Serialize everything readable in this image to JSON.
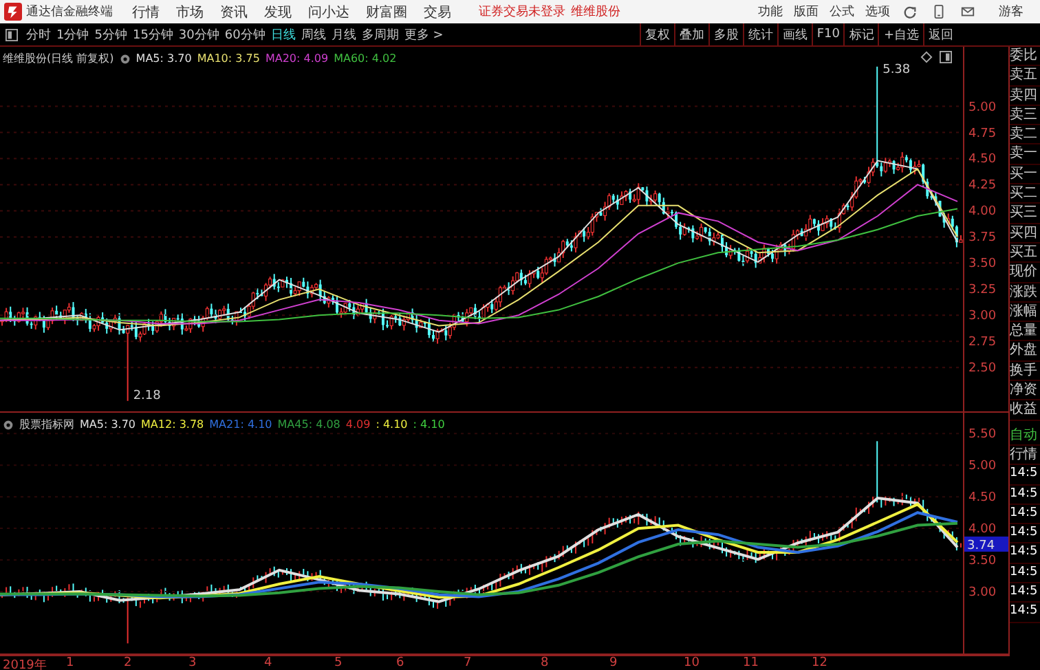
{
  "menubar": {
    "app_title": "通达信金融终端",
    "menus": [
      "行情",
      "市场",
      "资讯",
      "发现",
      "问小达",
      "财富圈",
      "交易"
    ],
    "notice": "证券交易未登录",
    "stock_name": "维维股份",
    "actions": [
      "功能",
      "版面",
      "公式",
      "选项"
    ],
    "user": "游客"
  },
  "toolbar": {
    "periods": [
      {
        "label": "分时",
        "selected": false
      },
      {
        "label": "1分钟",
        "selected": false
      },
      {
        "label": "5分钟",
        "selected": false
      },
      {
        "label": "15分钟",
        "selected": false
      },
      {
        "label": "30分钟",
        "selected": false
      },
      {
        "label": "60分钟",
        "selected": false
      },
      {
        "label": "日线",
        "selected": true
      },
      {
        "label": "周线",
        "selected": false
      },
      {
        "label": "月线",
        "selected": false
      },
      {
        "label": "多周期",
        "selected": false
      },
      {
        "label": "更多 >",
        "selected": false
      }
    ],
    "buttons": [
      "复权",
      "叠加",
      "多股",
      "统计",
      "画线",
      "F10",
      "标记",
      "+自选",
      "返回"
    ]
  },
  "main_chart": {
    "title": "维维股份(日线 前复权)",
    "readings": [
      ": 3.70",
      ": 3.75",
      ": 4.09",
      ": 4.02"
    ],
    "high_label": "5.38",
    "low_label": "2.18",
    "chart_data": {
      "type": "line",
      "grid": true,
      "ylim": [
        2.08,
        5.57
      ],
      "yticks": [
        {
          "value": 5.0,
          "label": "5.00"
        },
        {
          "value": 4.75,
          "label": "4.75"
        },
        {
          "value": 4.5,
          "label": "4.50"
        },
        {
          "value": 4.25,
          "label": "4.25"
        },
        {
          "value": 4.0,
          "label": "4.00"
        },
        {
          "value": 3.75,
          "label": "3.75"
        },
        {
          "value": 3.5,
          "label": "3.50"
        },
        {
          "value": 3.25,
          "label": "3.25"
        },
        {
          "value": 3.0,
          "label": "3.00"
        },
        {
          "value": 2.75,
          "label": "2.75"
        },
        {
          "value": 2.5,
          "label": "2.50"
        }
      ],
      "series": [
        {
          "name": "MA5",
          "color": "#e0e0e0",
          "values": [
            2.95,
            2.97,
            3.0,
            2.86,
            2.91,
            2.96,
            3.03,
            3.34,
            3.19,
            3.02,
            2.96,
            2.84,
            3.04,
            3.33,
            3.56,
            3.98,
            4.22,
            3.87,
            3.69,
            3.51,
            3.77,
            3.94,
            4.48,
            4.4,
            3.7
          ]
        },
        {
          "name": "MA10",
          "color": "#e8e070",
          "values": [
            2.95,
            2.96,
            2.98,
            2.93,
            2.9,
            2.93,
            2.98,
            3.15,
            3.25,
            3.1,
            3.0,
            2.9,
            2.93,
            3.15,
            3.42,
            3.7,
            4.05,
            4.05,
            3.8,
            3.6,
            3.62,
            3.85,
            4.15,
            4.4,
            3.75
          ]
        },
        {
          "name": "MA20",
          "color": "#d040d0",
          "values": [
            2.95,
            2.95,
            2.96,
            2.95,
            2.92,
            2.92,
            2.95,
            3.05,
            3.15,
            3.12,
            3.05,
            2.95,
            2.92,
            3.0,
            3.2,
            3.45,
            3.78,
            3.98,
            3.9,
            3.7,
            3.62,
            3.72,
            3.95,
            4.25,
            4.09
          ]
        },
        {
          "name": "MA60",
          "color": "#40c040",
          "values": [
            2.97,
            2.97,
            2.96,
            2.95,
            2.95,
            2.94,
            2.94,
            2.96,
            3.0,
            3.02,
            3.02,
            3.0,
            2.97,
            2.98,
            3.05,
            3.18,
            3.35,
            3.5,
            3.6,
            3.63,
            3.66,
            3.72,
            3.82,
            3.95,
            4.02
          ]
        }
      ]
    }
  },
  "indicator_chart": {
    "title": "股票指标网",
    "readings": [
      ": 3.70",
      ": 3.78",
      ": 4.10",
      ": 4.08"
    ],
    "extra_values": [
      {
        "text": "4.09",
        "color": "#e03030"
      },
      {
        "text": ": 4.10",
        "color": "#f0f040"
      },
      {
        "text": ": 4.10",
        "color": "#40d040"
      }
    ],
    "current_price": "3.74",
    "chart_data": {
      "type": "line",
      "grid": true,
      "ylim": [
        2.02,
        5.83
      ],
      "yticks": [
        {
          "value": 5.5,
          "label": "5.50"
        },
        {
          "value": 5.0,
          "label": "5.00"
        },
        {
          "value": 4.5,
          "label": "4.50"
        },
        {
          "value": 4.0,
          "label": "4.00"
        },
        {
          "value": 3.5,
          "label": "3.50"
        },
        {
          "value": 3.0,
          "label": "3.00"
        }
      ],
      "series": [
        {
          "name": "MA5",
          "color": "#e0e0e0",
          "values": [
            2.95,
            2.97,
            3.0,
            2.86,
            2.91,
            2.96,
            3.03,
            3.34,
            3.19,
            3.02,
            2.96,
            2.84,
            3.04,
            3.33,
            3.56,
            3.98,
            4.22,
            3.87,
            3.69,
            3.51,
            3.77,
            3.94,
            4.48,
            4.4,
            3.7
          ]
        },
        {
          "name": "MA12",
          "color": "#f0f040",
          "values": [
            2.95,
            2.96,
            2.98,
            2.94,
            2.9,
            2.93,
            2.97,
            3.12,
            3.24,
            3.12,
            3.01,
            2.91,
            2.93,
            3.12,
            3.38,
            3.66,
            4.0,
            4.05,
            3.82,
            3.62,
            3.62,
            3.82,
            4.1,
            4.38,
            3.78
          ]
        },
        {
          "name": "MA21",
          "color": "#3070e0",
          "values": [
            2.95,
            2.95,
            2.96,
            2.95,
            2.92,
            2.92,
            2.95,
            3.05,
            3.15,
            3.12,
            3.05,
            2.95,
            2.92,
            3.0,
            3.2,
            3.45,
            3.78,
            3.98,
            3.9,
            3.7,
            3.62,
            3.72,
            3.95,
            4.25,
            4.1
          ]
        },
        {
          "name": "MA45",
          "color": "#30a040",
          "values": [
            2.96,
            2.96,
            2.96,
            2.95,
            2.94,
            2.93,
            2.94,
            2.98,
            3.05,
            3.08,
            3.06,
            3.0,
            2.95,
            2.98,
            3.1,
            3.3,
            3.55,
            3.75,
            3.8,
            3.75,
            3.7,
            3.75,
            3.88,
            4.05,
            4.08
          ]
        }
      ]
    }
  },
  "x_axis": [
    "2019年",
    "1",
    "2",
    "3",
    "4",
    "5",
    "6",
    "7",
    "8",
    "9",
    "10",
    "11",
    "12"
  ],
  "quote_panel": {
    "labels": [
      "委比",
      "卖五",
      "卖四",
      "卖三",
      "卖二",
      "卖一",
      "买一",
      "买二",
      "买三",
      "买四",
      "买五",
      "现价",
      "涨跌",
      "涨幅",
      "总量",
      "外盘",
      "换手",
      "净资",
      "收益"
    ],
    "auto_label": "自动",
    "market_label": "行情",
    "times": [
      "14:5",
      "14:5",
      "14:5",
      "14:5",
      "14:5",
      "14:5",
      "14:5",
      "14:5"
    ]
  }
}
